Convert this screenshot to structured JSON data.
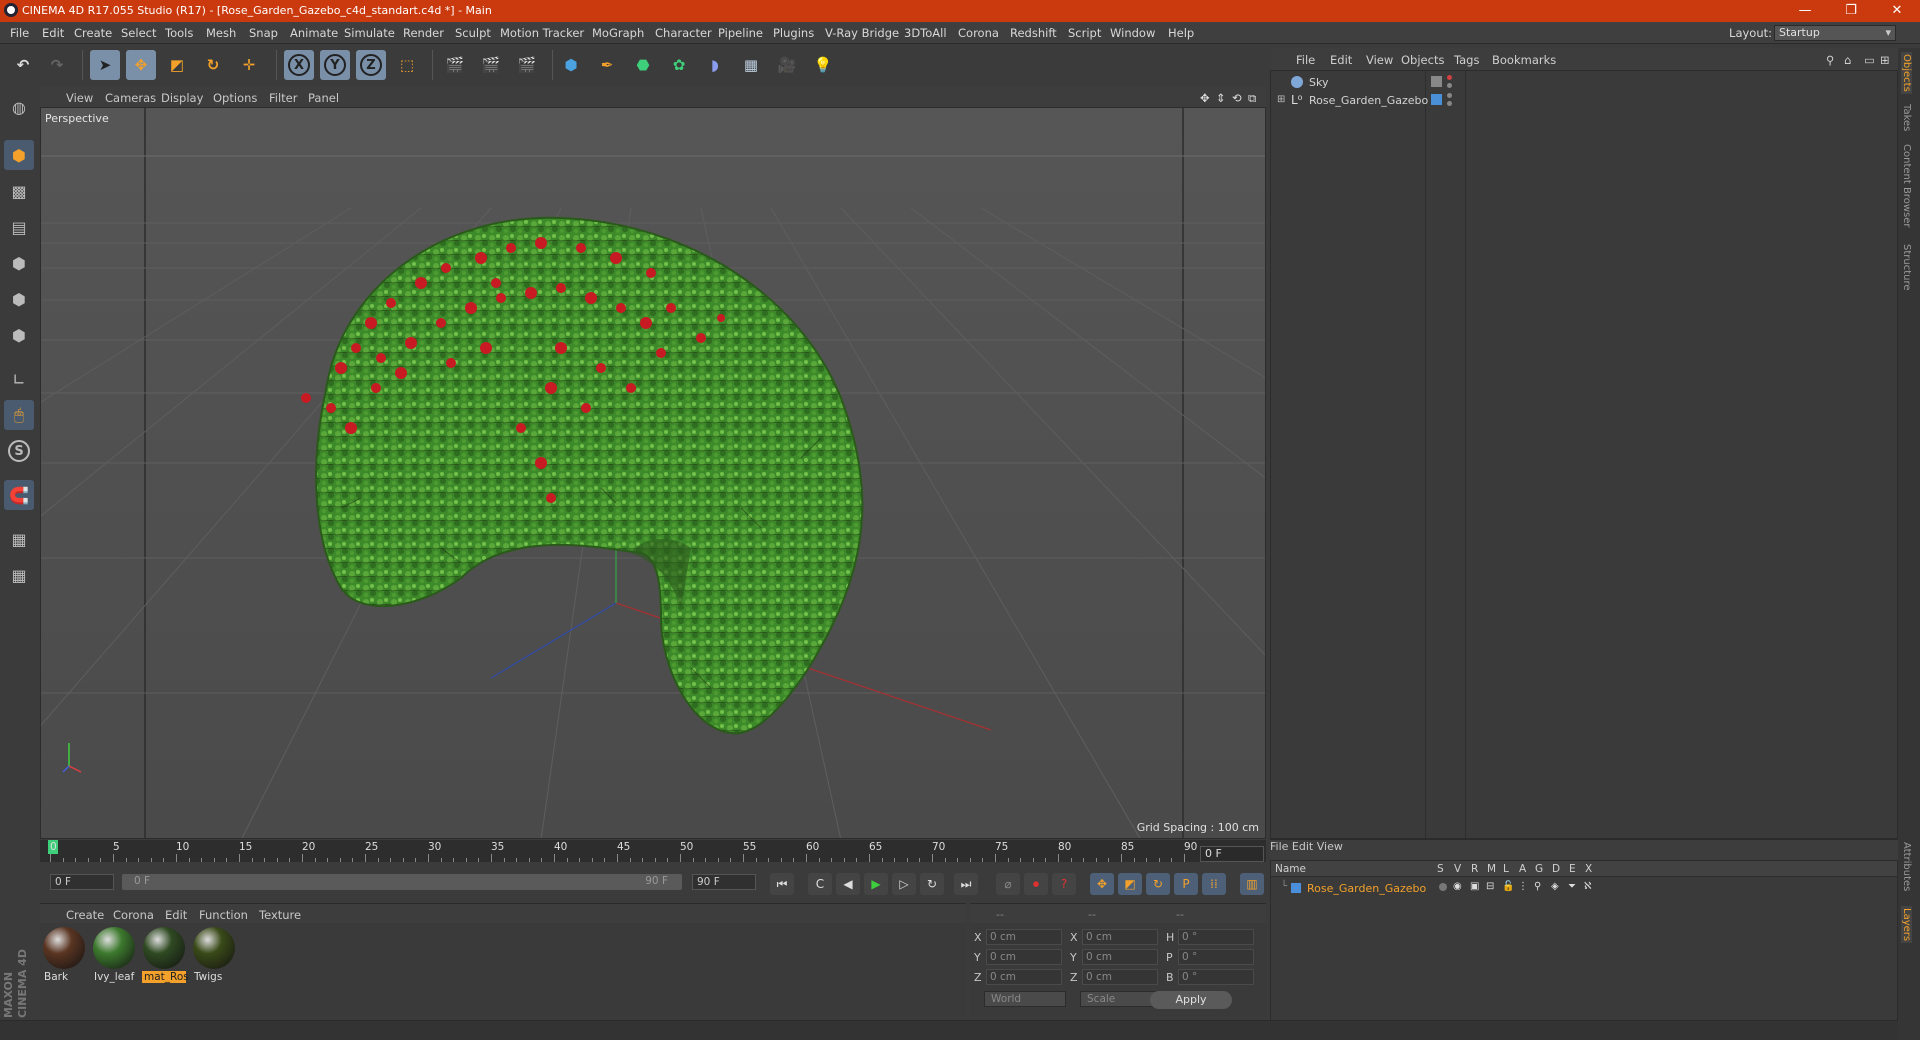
{
  "window": {
    "title": "CINEMA 4D R17.055 Studio (R17) - [Rose_Garden_Gazebo_c4d_standart.c4d *] - Main",
    "controls": [
      "—",
      "❐",
      "✕"
    ]
  },
  "menu": {
    "items": [
      "File",
      "Edit",
      "Create",
      "Select",
      "Tools",
      "Mesh",
      "Snap",
      "Animate",
      "Simulate",
      "Render",
      "Sculpt",
      "Motion Tracker",
      "MoGraph",
      "Character",
      "Pipeline",
      "Plugins",
      "V-Ray Bridge",
      "3DToAll",
      "Corona",
      "Redshift",
      "Script",
      "Window",
      "Help"
    ],
    "layout_label": "Layout:",
    "layout_value": "Startup"
  },
  "toolbar": {
    "axis_x": "X",
    "axis_y": "Y",
    "axis_z": "Z"
  },
  "viewport": {
    "menu": [
      "View",
      "Cameras",
      "Display",
      "Options",
      "Filter",
      "Panel"
    ],
    "label": "Perspective",
    "grid_spacing": "Grid Spacing : 100 cm"
  },
  "timeline": {
    "ticks": [
      "0",
      "5",
      "10",
      "15",
      "20",
      "25",
      "30",
      "35",
      "40",
      "45",
      "50",
      "55",
      "60",
      "65",
      "70",
      "75",
      "80",
      "85",
      "90"
    ],
    "current_frame": "0 F",
    "start_field": "0 F",
    "range_start": "0 F",
    "range_end": "90 F",
    "end_field": "90 F"
  },
  "materials": {
    "menu": [
      "Create",
      "Corona",
      "Edit",
      "Function",
      "Texture"
    ],
    "items": [
      {
        "name": "Bark",
        "color": "#5a3522"
      },
      {
        "name": "Ivy_leaf",
        "color": "#3d7a2e"
      },
      {
        "name": "mat_Ros",
        "color": "#2f4a22"
      },
      {
        "name": "Twigs",
        "color": "#3a4a18"
      }
    ]
  },
  "coordinates": {
    "header": [
      "--",
      "--",
      "--"
    ],
    "rows": [
      {
        "l1": "X",
        "v1": "0 cm",
        "l2": "X",
        "v2": "0 cm",
        "l3": "H",
        "v3": "0 °"
      },
      {
        "l1": "Y",
        "v1": "0 cm",
        "l2": "Y",
        "v2": "0 cm",
        "l3": "P",
        "v3": "0 °"
      },
      {
        "l1": "Z",
        "v1": "0 cm",
        "l2": "Z",
        "v2": "0 cm",
        "l3": "B",
        "v3": "0 °"
      }
    ],
    "mode_select": "World",
    "scale_select": "Scale",
    "apply_label": "Apply"
  },
  "objects": {
    "menu": [
      "File",
      "Edit",
      "View",
      "Objects",
      "Tags",
      "Bookmarks"
    ],
    "rows": [
      {
        "name": "Sky"
      },
      {
        "name": "Rose_Garden_Gazebo"
      }
    ]
  },
  "layers": {
    "menu": [
      "File",
      "Edit",
      "View"
    ],
    "columns": [
      "Name",
      "S",
      "V",
      "R",
      "M",
      "L",
      "A",
      "G",
      "D",
      "E",
      "X"
    ],
    "rows": [
      {
        "name": "Rose_Garden_Gazebo",
        "color": "#4a90d9"
      }
    ]
  },
  "side_tabs": [
    "Objects",
    "Takes",
    "Content Browser",
    "Structure",
    "Attributes",
    "Layers"
  ],
  "branding": "MAXON CINEMA 4D",
  "colors": {
    "accent": "#f3a12a",
    "titlebar": "#cb3a0e",
    "foliage": "#3f8a2a",
    "roses": "#c81a22"
  }
}
